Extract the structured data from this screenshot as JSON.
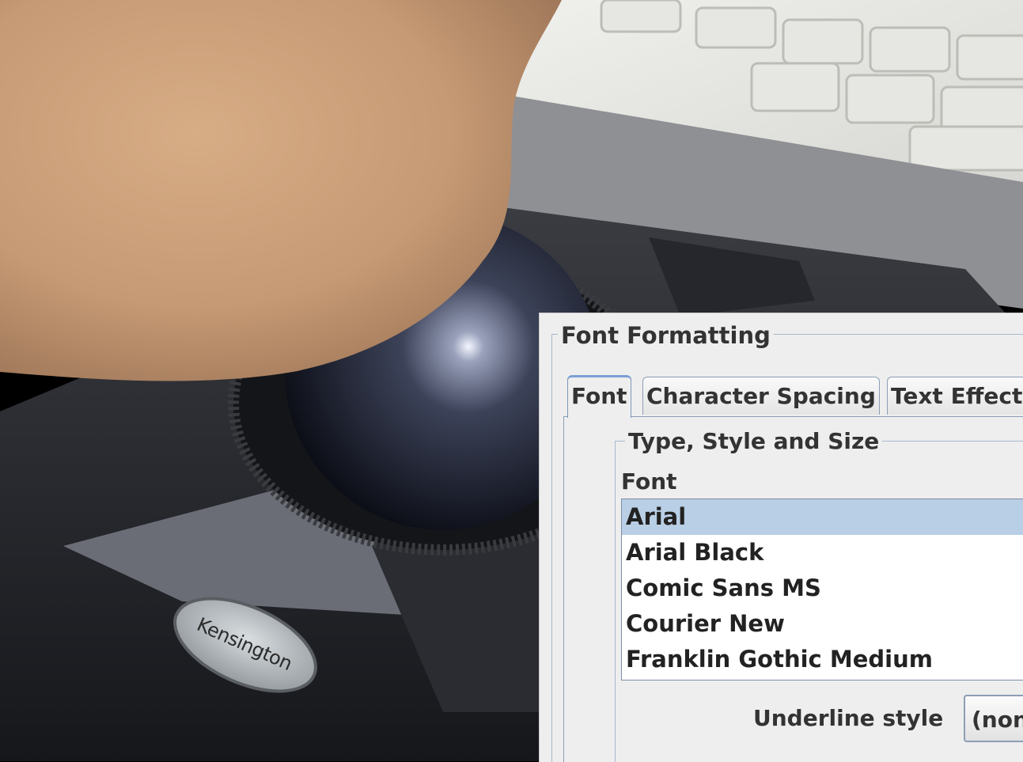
{
  "photo": {
    "description_icon": "trackball-photo",
    "brand_label": "Kensington"
  },
  "dialog": {
    "title": "Font Formatting",
    "tabs": [
      {
        "label": "Font",
        "active": true
      },
      {
        "label": "Character Spacing",
        "active": false
      },
      {
        "label": "Text Effect",
        "active": false
      }
    ],
    "group_title": "Type, Style and Size",
    "font_label": "Font",
    "font_list": [
      {
        "label": "Arial",
        "selected": true
      },
      {
        "label": "Arial Black",
        "selected": false
      },
      {
        "label": "Comic Sans MS",
        "selected": false
      },
      {
        "label": "Courier New",
        "selected": false
      },
      {
        "label": "Franklin Gothic Medium",
        "selected": false
      }
    ],
    "underline_label": "Underline style",
    "underline_value": "(non"
  },
  "colors": {
    "selection": "#b8cfe5",
    "tab_accent": "#7aa0d6",
    "panel_bg": "#eeeeee"
  }
}
